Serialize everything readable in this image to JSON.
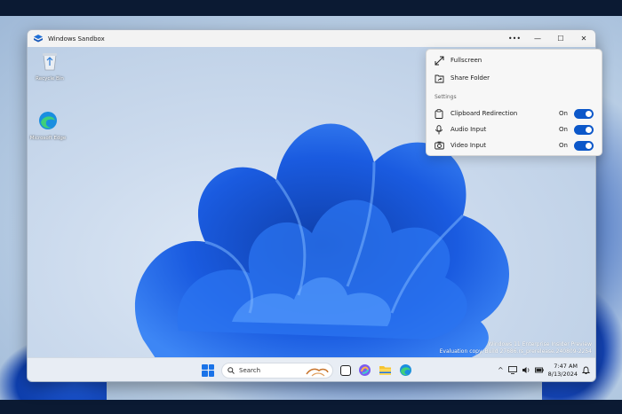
{
  "window": {
    "title": "Windows Sandbox",
    "controls": {
      "more": "•••",
      "minimize": "—",
      "maximize": "☐",
      "close": "✕"
    }
  },
  "desktop_icons": [
    {
      "label": "Recycle Bin",
      "icon": "recycle-bin-icon"
    },
    {
      "label": "Microsoft Edge",
      "icon": "edge-icon"
    }
  ],
  "watermark": {
    "line1": "Windows 11 Enterprise Insider Preview",
    "line2": "Evaluation copy. Build 27686.rs_prerelease.240809-2254"
  },
  "taskbar": {
    "search_placeholder": "Search",
    "apps": [
      "start-icon",
      "search-icon",
      "task-view-icon",
      "copilot-icon",
      "file-explorer-icon",
      "edge-icon"
    ],
    "tray": {
      "chevron": "^",
      "time": "7:47 AM",
      "date": "8/13/2024"
    }
  },
  "flyout": {
    "items": [
      {
        "label": "Fullscreen",
        "icon": "fullscreen-icon"
      },
      {
        "label": "Share Folder",
        "icon": "share-folder-icon"
      }
    ],
    "section_title": "Settings",
    "settings": [
      {
        "label": "Clipboard Redirection",
        "state": "On",
        "enabled": true,
        "icon": "clipboard-icon"
      },
      {
        "label": "Audio Input",
        "state": "On",
        "enabled": true,
        "icon": "microphone-icon"
      },
      {
        "label": "Video Input",
        "state": "On",
        "enabled": true,
        "icon": "camera-icon"
      }
    ]
  },
  "colors": {
    "accent": "#0b57c9",
    "bloom": "#1a5be0"
  }
}
